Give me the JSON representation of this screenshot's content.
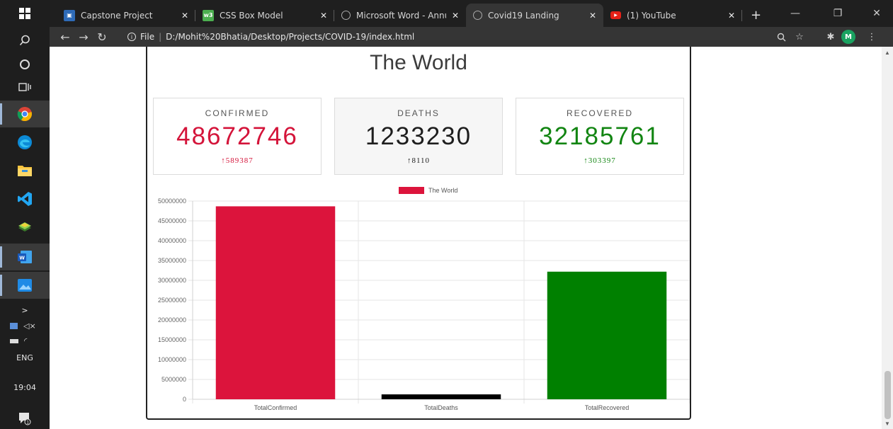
{
  "taskbar": {
    "language": "ENG",
    "clock": "19:04",
    "icons": [
      "windows-start-icon",
      "search-icon",
      "cortana-icon",
      "task-view-icon",
      "chrome-icon",
      "edge-icon",
      "file-explorer-icon",
      "vscode-icon",
      "bluestacks-icon",
      "word-icon",
      "photos-icon"
    ],
    "notification_badge": "1"
  },
  "browser": {
    "tabs": [
      {
        "label": "Capstone Project",
        "favicon": "capstone",
        "active": false
      },
      {
        "label": "CSS Box Model",
        "favicon": "w3",
        "active": false
      },
      {
        "label": "Microsoft Word - Annual",
        "favicon": "globe",
        "active": false
      },
      {
        "label": "Covid19 Landing",
        "favicon": "globe",
        "active": true
      },
      {
        "label": "(1) YouTube",
        "favicon": "youtube",
        "active": false
      }
    ],
    "new_tab": "+",
    "favicon_w3_text": "w3",
    "address_prefix": "File",
    "address_url": "D:/Mohit%20Bhatia/Desktop/Projects/COVID-19/index.html",
    "profile_initial": "M"
  },
  "page": {
    "title": "The World",
    "cards": [
      {
        "label": "CONFIRMED",
        "value": "48672746",
        "delta": "589387",
        "color": "#d4143a"
      },
      {
        "label": "DEATHS",
        "value": "1233230",
        "delta": "8110",
        "color": "#1e1e1e"
      },
      {
        "label": "RECOVERED",
        "value": "32185761",
        "delta": "303397",
        "color": "#128512"
      }
    ],
    "delta_arrow": "↑"
  },
  "chart_data": {
    "type": "bar",
    "categories": [
      "TotalConfirmed",
      "TotalDeaths",
      "TotalRecovered"
    ],
    "series": [
      {
        "name": "The World",
        "values": [
          48672746,
          1233230,
          32185761
        ],
        "colors": [
          "#dc143c",
          "#000000",
          "#008000"
        ]
      }
    ],
    "legend_color": "#dc143c",
    "legend_position": "top",
    "ylim": [
      0,
      50000000
    ],
    "yticks": [
      "0",
      "5000000",
      "10000000",
      "15000000",
      "20000000",
      "25000000",
      "30000000",
      "35000000",
      "40000000",
      "45000000",
      "50000000"
    ],
    "grid": true
  }
}
